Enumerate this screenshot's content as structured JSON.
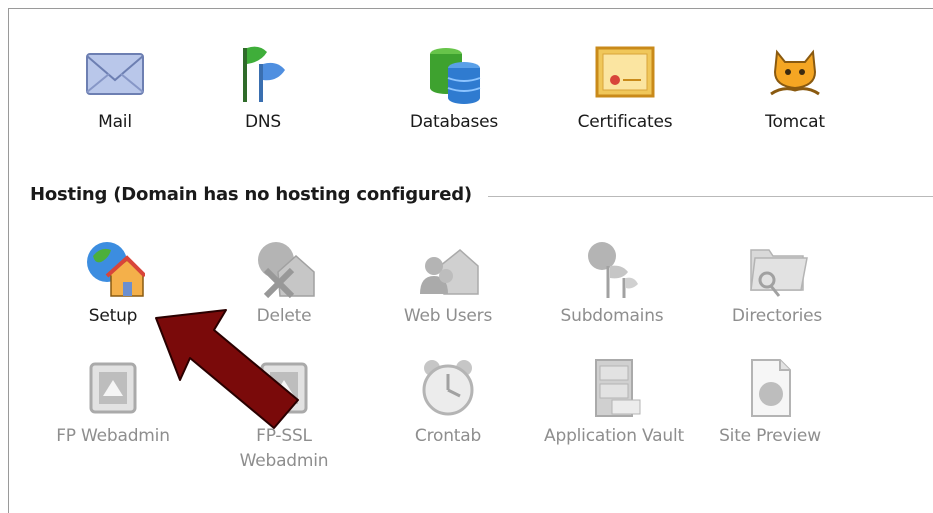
{
  "top_tools": [
    {
      "label": "Mail",
      "icon": "mail-icon"
    },
    {
      "label": "DNS",
      "icon": "dns-icon"
    },
    {
      "label": "Databases",
      "icon": "databases-icon"
    },
    {
      "label": "Certificates",
      "icon": "certificates-icon"
    },
    {
      "label": "Tomcat",
      "icon": "tomcat-icon"
    }
  ],
  "hosting": {
    "title": "Hosting (Domain has no hosting configured)",
    "tools": [
      {
        "label": "Setup",
        "icon": "setup-icon",
        "enabled": true
      },
      {
        "label": "Delete",
        "icon": "delete-icon",
        "enabled": false
      },
      {
        "label": "Web Users",
        "icon": "web-users-icon",
        "enabled": false
      },
      {
        "label": "Subdomains",
        "icon": "subdomains-icon",
        "enabled": false
      },
      {
        "label": "Directories",
        "icon": "directories-icon",
        "enabled": false
      },
      {
        "label": "FP Webadmin",
        "icon": "fp-webadmin-icon",
        "enabled": false
      },
      {
        "label": "FP-SSL Webadmin",
        "icon": "fp-ssl-webadmin-icon",
        "enabled": false
      },
      {
        "label": "Crontab",
        "icon": "crontab-icon",
        "enabled": false
      },
      {
        "label": "Application Vault",
        "icon": "application-vault-icon",
        "enabled": false
      },
      {
        "label": "Site Preview",
        "icon": "site-preview-icon",
        "enabled": false
      }
    ]
  },
  "annotation": {
    "icon": "red-arrow-icon",
    "color": "#7a0a0a"
  }
}
